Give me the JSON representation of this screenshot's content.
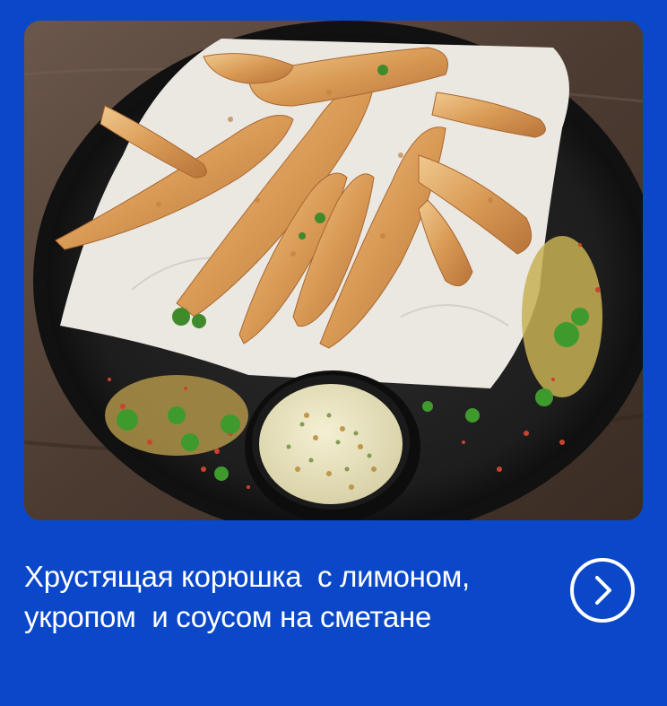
{
  "card": {
    "image_subject": "fried-smelt-dish-photo",
    "caption_line1": "Хрустящая корюшка  с лимоном,",
    "caption_line2": "укропом  и соусом на сметане",
    "next_icon": "chevron-right-circle-icon"
  },
  "colors": {
    "background": "#0a48c9",
    "text": "#ffffff"
  }
}
